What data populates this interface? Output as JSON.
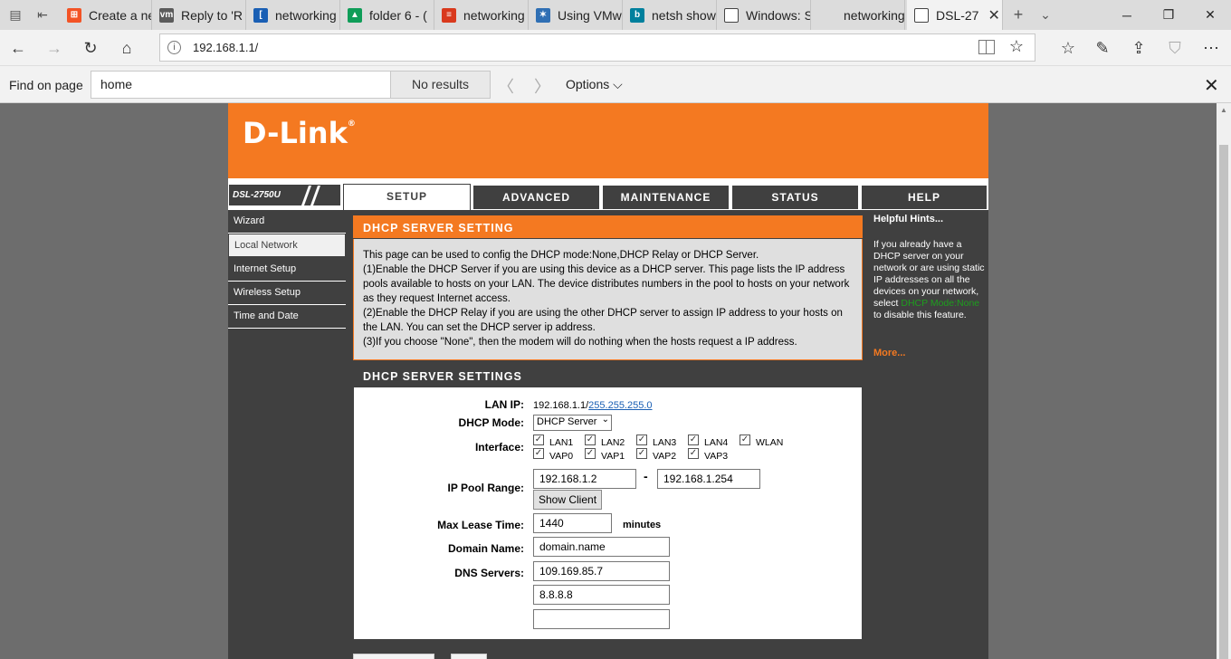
{
  "browser": {
    "tabs": [
      {
        "label": "Create a ne",
        "icon": "microsoft-logo-icon",
        "color": "#f35325"
      },
      {
        "label": "Reply to 'R",
        "icon": "vmware-logo-icon",
        "color": "#5b5b5b"
      },
      {
        "label": "networking",
        "icon": "bracket-icon",
        "color": "#1a5fb4"
      },
      {
        "label": "folder 6 - (",
        "icon": "google-drive-icon",
        "color": "#0f9d58"
      },
      {
        "label": "networking",
        "icon": "stack-icon",
        "color": "#d9391d"
      },
      {
        "label": "Using VMw",
        "icon": "star-icon",
        "color": "#2f6fb4"
      },
      {
        "label": "netsh show",
        "icon": "bing-icon",
        "color": "#00809d"
      },
      {
        "label": "Windows: S",
        "icon": "window-icon",
        "color": "#444444"
      },
      {
        "label": "networking",
        "icon": "blank-icon",
        "color": "#dcdcdc"
      },
      {
        "label": "DSL-27",
        "icon": "page-icon",
        "color": "#444444"
      }
    ],
    "address": "192.168.1.1/",
    "find": {
      "label": "Find on page",
      "query": "home",
      "results": "No results",
      "options": "Options"
    }
  },
  "router": {
    "logo": "D-Link",
    "model": "DSL-2750U",
    "tabs": [
      "SETUP",
      "ADVANCED",
      "MAINTENANCE",
      "STATUS",
      "HELP"
    ],
    "left_nav": [
      "Wizard",
      "Local Network",
      "Internet Setup",
      "Wireless Setup",
      "Time and Date"
    ],
    "intro": {
      "title": "DHCP SERVER SETTING",
      "lines": [
        "This page can be used to config the DHCP mode:None,DHCP Relay or DHCP Server.",
        "(1)Enable the DHCP Server if you are using this device as a DHCP server. This page lists the IP address pools available to hosts on your LAN. The device distributes numbers in the pool to hosts on your network as they request Internet access.",
        "(2)Enable the DHCP Relay if you are using the other DHCP server to assign IP address to your hosts on the LAN. You can set the DHCP server ip address.",
        "(3)If you choose \"None\", then the modem will do nothing when the hosts request a IP address."
      ]
    },
    "settings": {
      "title": "DHCP SERVER SETTINGS",
      "lan_ip_label": "LAN IP:",
      "lan_ip": "192.168.1.1/",
      "lan_mask": "255.255.255.0",
      "dhcp_mode_label": "DHCP Mode:",
      "dhcp_mode": "DHCP Server",
      "interface_label": "Interface:",
      "interfaces_row1": [
        "LAN1",
        "LAN2",
        "LAN3",
        "LAN4",
        "WLAN"
      ],
      "interfaces_row2": [
        "VAP0",
        "VAP1",
        "VAP2",
        "VAP3"
      ],
      "ip_pool_label": "IP Pool Range:",
      "ip_pool_start": "192.168.1.2",
      "ip_pool_dash": "-",
      "ip_pool_end": "192.168.1.254",
      "show_client": "Show Client",
      "max_lease_label": "Max Lease Time:",
      "max_lease": "1440",
      "max_lease_unit": "minutes",
      "domain_label": "Domain Name:",
      "domain": "domain.name",
      "dns_label": "DNS Servers:",
      "dns1": "109.169.85.7",
      "dns2": "8.8.8.8",
      "dns3": ""
    },
    "hints": {
      "title": "Helpful Hints...",
      "text_before": "If you already have a DHCP server on your network or are using static IP addresses on all the devices on your network, select ",
      "text_link": "DHCP Mode:None",
      "text_after": " to disable this feature.",
      "more": "More..."
    }
  }
}
